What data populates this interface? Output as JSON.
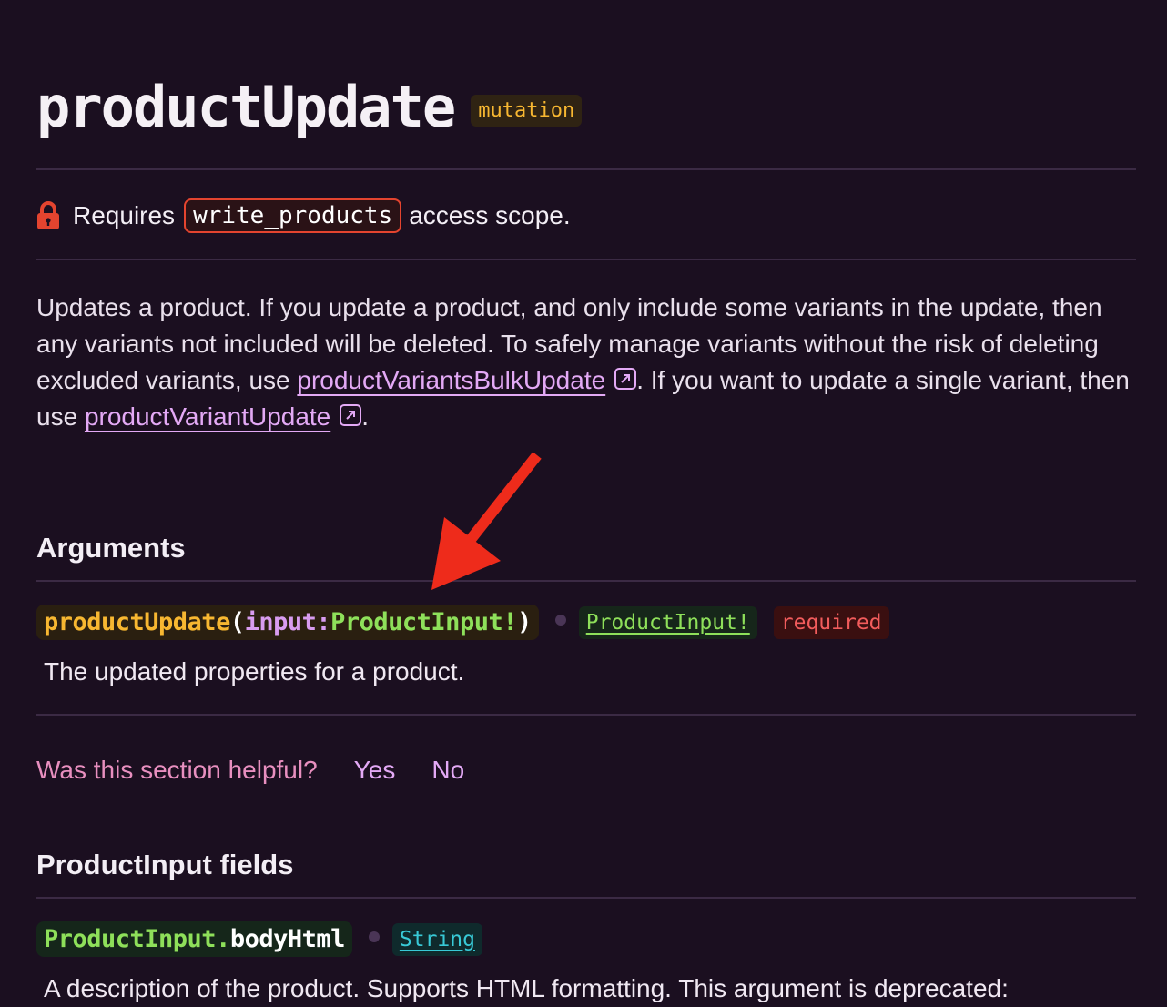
{
  "header": {
    "title": "productUpdate",
    "kind_badge": "mutation"
  },
  "scope": {
    "prefix": "Requires",
    "code": "write_products",
    "suffix": "access scope."
  },
  "description": {
    "part1": "Updates a product. If you update a product, and only include some variants in the update, then any variants not included will be deleted. To safely manage variants without the risk of deleting excluded variants, use ",
    "link1": "productVariantsBulkUpdate",
    "part2": ". If you want to update a single variant, then use ",
    "link2": "productVariantUpdate",
    "part3": "."
  },
  "arguments": {
    "heading": "Arguments",
    "signature": {
      "fn": "productUpdate",
      "open": "(",
      "arg": "input",
      "colon": ":",
      "type": "ProductInput!",
      "close": ")"
    },
    "type_badge": "ProductInput!",
    "required_badge": "required",
    "description": "The updated properties for a product."
  },
  "feedback": {
    "question": "Was this section helpful?",
    "yes": "Yes",
    "no": "No"
  },
  "input_fields": {
    "heading": "ProductInput fields",
    "field": {
      "type": "ProductInput.",
      "name": "bodyHtml"
    },
    "type_badge": "String",
    "description": "A description of the product. Supports HTML formatting. This argument is deprecated:"
  },
  "colors": {
    "background": "#1b0f20",
    "accent_link": "#e3a9f5",
    "mutation_badge": "#f7b731",
    "required": "#f25c5c",
    "type_green": "#8ee05a",
    "string_teal": "#38c9d6",
    "annotation_arrow": "#ee2b1b"
  }
}
